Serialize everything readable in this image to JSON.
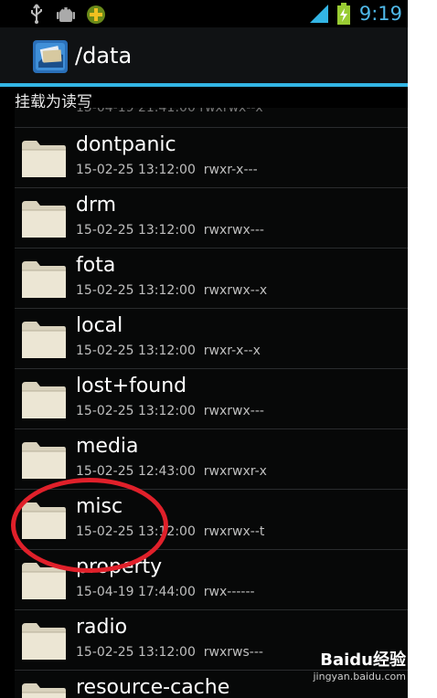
{
  "status_bar": {
    "time": "9:19",
    "colors": {
      "time": "#4fb8e8"
    },
    "icons": [
      "usb-icon",
      "android-debug-icon",
      "notification-app-icon",
      "signal-icon",
      "battery-charging-icon"
    ]
  },
  "action_bar": {
    "title": "/data",
    "app_icon": "file-manager-icon"
  },
  "mount_label": "挂载为读写",
  "files": [
    {
      "name": "dontpanic",
      "date": "15-02-25 13:12:00",
      "perms": "rwxr-x---"
    },
    {
      "name": "drm",
      "date": "15-02-25 13:12:00",
      "perms": "rwxrwx---"
    },
    {
      "name": "fota",
      "date": "15-02-25 13:12:00",
      "perms": "rwxrwx--x"
    },
    {
      "name": "local",
      "date": "15-02-25 13:12:00",
      "perms": "rwxr-x--x"
    },
    {
      "name": "lost+found",
      "date": "15-02-25 13:12:00",
      "perms": "rwxrwx---"
    },
    {
      "name": "media",
      "date": "15-02-25 12:43:00",
      "perms": "rwxrwxr-x"
    },
    {
      "name": "misc",
      "date": "15-02-25 13:12:00",
      "perms": "rwxrwx--t"
    },
    {
      "name": "property",
      "date": "15-04-19 17:44:00",
      "perms": "rwx------"
    },
    {
      "name": "radio",
      "date": "15-02-25 13:12:00",
      "perms": "rwxrws---"
    },
    {
      "name": "resource-cache",
      "date": "",
      "perms": ""
    }
  ],
  "watermark": {
    "brand": "Baidu经验",
    "url": "jingyan.baidu.com"
  },
  "accent_color": "#33b5e5",
  "highlight_color": "#e0202a"
}
